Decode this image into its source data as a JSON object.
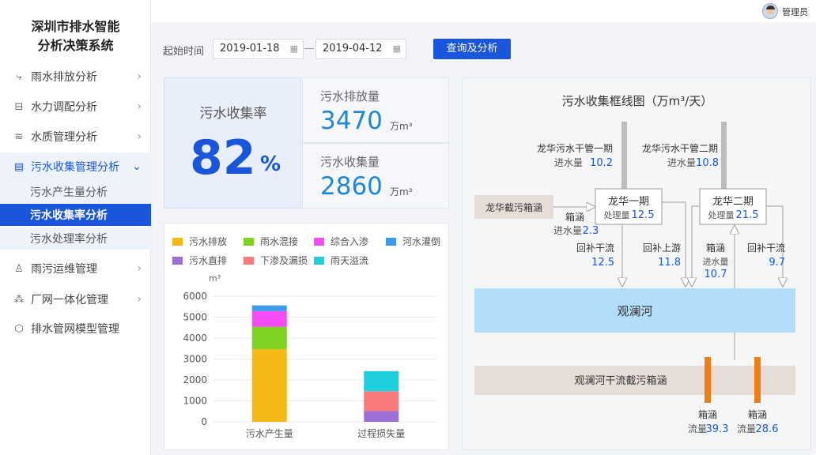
{
  "app": {
    "title_line1": "深圳市排水智能",
    "title_line2": "分析决策系统"
  },
  "header": {
    "user_name": "管理员"
  },
  "sidebar": {
    "items": [
      {
        "label": "雨水排放分析",
        "icon": "rain-drain-icon"
      },
      {
        "label": "水力调配分析",
        "icon": "hydraulic-icon"
      },
      {
        "label": "水质管理分析",
        "icon": "water-quality-icon"
      },
      {
        "label": "污水收集管理分析",
        "icon": "sewage-doc-icon"
      },
      {
        "label": "雨污运维管理",
        "icon": "user-icon"
      },
      {
        "label": "厂网一体化管理",
        "icon": "network-icon"
      },
      {
        "label": "排水管网模型管理",
        "icon": "cube-icon"
      }
    ],
    "subitems": [
      {
        "label": "污水产生量分析"
      },
      {
        "label": "污水收集率分析"
      },
      {
        "label": "污水处理率分析"
      }
    ]
  },
  "filter": {
    "label": "起始时间",
    "start_date": "2019-01-18",
    "end_date": "2019-04-12",
    "query_label": "查询及分析"
  },
  "kpis": {
    "rate_label": "污水收集率",
    "rate_value": "82",
    "rate_unit": "%",
    "discharge_label": "污水排放量",
    "discharge_value": "3470",
    "discharge_unit": "万m³",
    "collect_label": "污水收集量",
    "collect_value": "2860",
    "collect_unit": "万m³"
  },
  "chart_data": {
    "type": "bar",
    "stacked": true,
    "categories": [
      "污水产生量",
      "过程损失量"
    ],
    "ylabel": "m³",
    "ylim": [
      0,
      6000
    ],
    "yticks": [
      0,
      1000,
      2000,
      3000,
      4000,
      5000,
      6000
    ],
    "grid": true,
    "legend_position": "top",
    "series": [
      {
        "name": "污水排放",
        "color": "#f5b915",
        "values": [
          3470,
          0
        ]
      },
      {
        "name": "雨水混接",
        "color": "#7ed321",
        "values": [
          1070,
          0
        ]
      },
      {
        "name": "综合入渗",
        "color": "#f54cf5",
        "values": [
          750,
          0
        ]
      },
      {
        "name": "河水灌倒",
        "color": "#3d9be9",
        "values": [
          270,
          0
        ]
      },
      {
        "name": "污水直排",
        "color": "#9b6fd6",
        "values": [
          0,
          510
        ]
      },
      {
        "name": "下渗及漏损",
        "color": "#f87a7a",
        "values": [
          0,
          950
        ]
      },
      {
        "name": "雨天溢流",
        "color": "#1dd0dc",
        "values": [
          0,
          960
        ]
      }
    ]
  },
  "flow": {
    "title": "污水收集框线图（万m³/天）",
    "main_pipe1": "龙华污水干管一期",
    "main_pipe1_in_label": "进水量",
    "main_pipe1_in_value": "10.2",
    "main_pipe2": "龙华污水干管二期",
    "main_pipe2_in_label": "进水量",
    "main_pipe2_in_value": "10.8",
    "interceptor": "龙华截污箱涵",
    "box_label": "箱涵",
    "box_in_label": "进水量",
    "box_in_value": "2.3",
    "plant1_name": "龙华一期",
    "plant1_cap_label": "处理量",
    "plant1_cap_value": "12.5",
    "plant2_name": "龙华二期",
    "plant2_cap_label": "处理量",
    "plant2_cap_value": "21.5",
    "rb1_label": "回补干流",
    "rb1_value": "12.5",
    "rb2_label": "回补上游",
    "rb2_value": "11.8",
    "rb3_label": "箱涵",
    "rb3_sub_label": "进水量",
    "rb3_value": "10.7",
    "rb4_label": "回补干流",
    "rb4_value": "9.7",
    "river": "观澜河",
    "trunk_box": "观澜河干流截污箱涵",
    "out1_label": "箱涵",
    "out1_flow_label": "流量",
    "out1_value": "39.3",
    "out2_label": "箱涵",
    "out2_flow_label": "流量",
    "out2_value": "28.6"
  }
}
